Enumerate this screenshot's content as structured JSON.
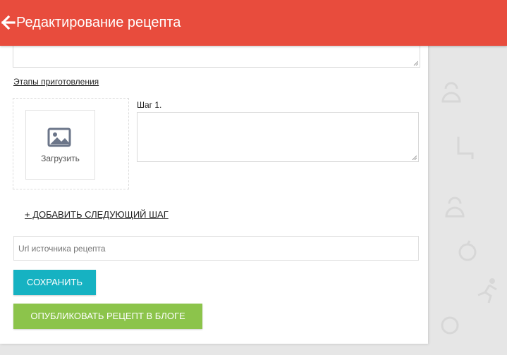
{
  "header": {
    "title": "Редактирование рецепта",
    "background": "#e84c3d",
    "back_icon": "arrow-left-icon"
  },
  "form": {
    "steps_section_label": "Этапы приготовления",
    "upload": {
      "label": "Загрузить",
      "icon": "image-icon"
    },
    "steps": [
      {
        "label": "Шаг 1.",
        "value": ""
      }
    ],
    "add_step_label": "+ ДОБАВИТЬ СЛЕДУЮЩИЙ ШАГ",
    "source_url": {
      "value": "",
      "placeholder": "Url источника рецепта"
    },
    "save_button": {
      "label": "СОХРАНИТЬ",
      "color": "#16b2c2"
    },
    "publish_button": {
      "label": "ОПУБЛИКОВАТЬ РЕЦЕПТ В БЛОГЕ",
      "color": "#8cc44b"
    }
  },
  "background_decor": [
    "kettlebell-icon",
    "apple-icon",
    "runner-icon",
    "chair-icon",
    "whistle-icon"
  ]
}
